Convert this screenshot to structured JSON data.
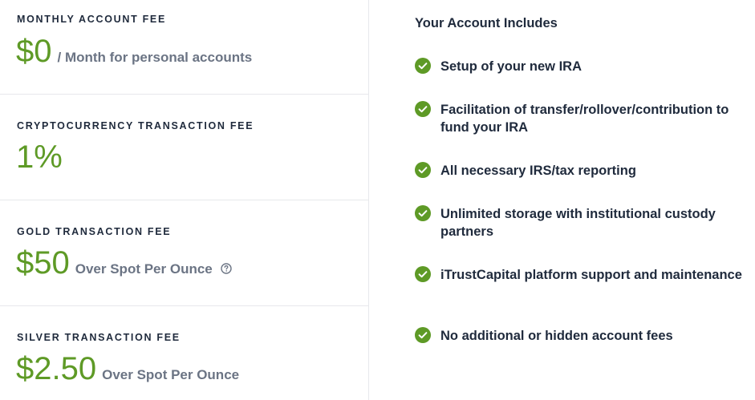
{
  "fees": [
    {
      "label": "MONTHLY ACCOUNT FEE",
      "amount": "$0",
      "suffix": "/ Month for personal accounts"
    },
    {
      "label": "CRYPTOCURRENCY TRANSACTION FEE",
      "amount": "1%",
      "suffix": ""
    },
    {
      "label": "GOLD TRANSACTION FEE",
      "amount": "$50",
      "suffix": "Over Spot Per Ounce",
      "help_icon": "question-circle-icon"
    },
    {
      "label": "SILVER TRANSACTION FEE",
      "amount": "$2.50",
      "suffix": "Over Spot Per Ounce"
    }
  ],
  "includes": {
    "title": "Your Account Includes",
    "items": [
      "Setup of your new IRA",
      "Facilitation of transfer/rollover/contribution to fund your IRA",
      "All necessary IRS/tax reporting",
      "Unlimited storage with institutional custody partners",
      "iTrustCapital platform support and maintenance",
      "No additional or hidden account fees"
    ],
    "check_icon": "check-circle-icon"
  },
  "colors": {
    "accent_green": "#5e9a26",
    "heading_text": "#1f2a3c",
    "muted_text": "#6b7484",
    "divider": "#e7e8ec"
  }
}
